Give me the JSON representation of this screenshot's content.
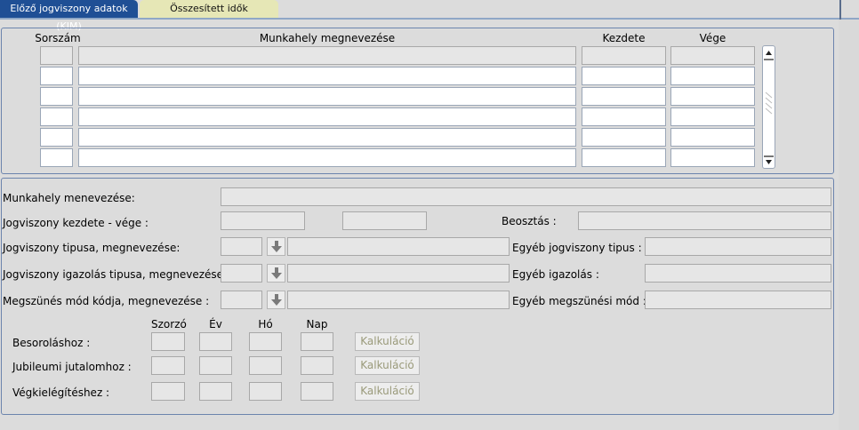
{
  "tabs": [
    {
      "label": "Előző jogviszony adatok (KIM)"
    },
    {
      "label": "Összesített idők"
    }
  ],
  "table": {
    "headers": {
      "sorszam": "Sorszám",
      "munkahely": "Munkahely megnevezése",
      "kezdete": "Kezdete",
      "vege": "Vége"
    },
    "rows": [
      {
        "sorszam": "",
        "munkahely": "",
        "kezdete": "",
        "vege": ""
      },
      {
        "sorszam": "",
        "munkahely": "",
        "kezdete": "",
        "vege": ""
      },
      {
        "sorszam": "",
        "munkahely": "",
        "kezdete": "",
        "vege": ""
      },
      {
        "sorszam": "",
        "munkahely": "",
        "kezdete": "",
        "vege": ""
      },
      {
        "sorszam": "",
        "munkahely": "",
        "kezdete": "",
        "vege": ""
      },
      {
        "sorszam": "",
        "munkahely": "",
        "kezdete": "",
        "vege": ""
      }
    ]
  },
  "detail": {
    "munkahely_label": "Munkahely menevezése:",
    "jogviszony_kv_label": "Jogviszony kezdete - vége :",
    "beosztas_label": "Beosztás :",
    "jogviszony_tipus_label": "Jogviszony tipusa, megnevezése:",
    "egyeb_jogviszony_label": "Egyéb jogviszony tipus :",
    "igazolas_label": "Jogviszony igazolás tipusa, megnevezése:",
    "egyeb_igazolas_label": "Egyéb igazolás :",
    "megszunes_label": "Megszünés mód kódja, megnevezése :",
    "egyeb_megszunes_label": "Egyéb megszünési mód :"
  },
  "calc": {
    "headers": {
      "szorzo": "Szorzó",
      "ev": "Év",
      "ho": "Hó",
      "nap": "Nap"
    },
    "rows": [
      {
        "label": "Besoroláshoz :",
        "button": "Kalkuláció"
      },
      {
        "label": "Jubileumi jutalomhoz :",
        "button": "Kalkuláció"
      },
      {
        "label": "Végkielégítéshez :",
        "button": "Kalkuláció"
      }
    ]
  }
}
